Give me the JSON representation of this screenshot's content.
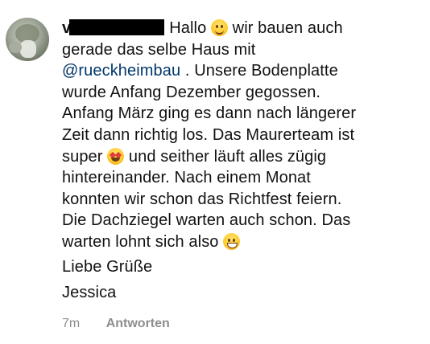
{
  "comment": {
    "username": "v",
    "lines": [
      "Hallo",
      "wir bauen auch",
      "gerade das selbe Haus mit",
      "@rueckheimbau",
      ". Unsere Bodenplatte",
      "wurde Anfang Dezember gegossen.",
      "Anfang März ging es dann nach längerer",
      "Zeit dann richtig los. Das Maurerteam ist",
      "super",
      "und seither läuft alles zügig",
      "hintereinander. Nach einem Monat",
      "konnten wir schon das Richtfest feiern.",
      "Die Dachziegel warten auch schon. Das",
      "warten lohnt sich also",
      "Liebe Grüße",
      "Jessica"
    ],
    "emoji": {
      "smile": "smiling-face-icon",
      "star": "star-struck-icon",
      "grin": "grinning-face-icon"
    }
  },
  "meta": {
    "time": "7m",
    "reply_label": "Antworten"
  }
}
